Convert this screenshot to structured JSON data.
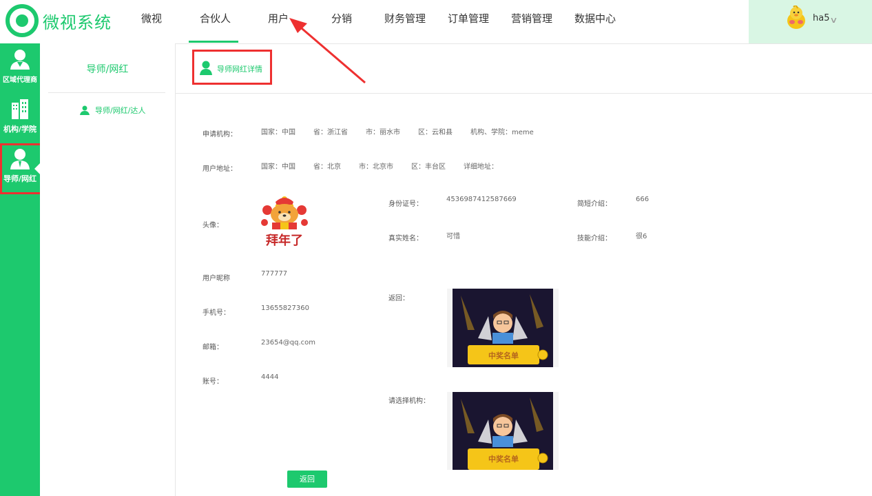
{
  "app": {
    "name": "微视系统"
  },
  "nav": {
    "items": [
      "微视",
      "合伙人",
      "用户",
      "分销",
      "财务管理",
      "订单管理",
      "营销管理",
      "数据中心"
    ],
    "active": "合伙人"
  },
  "user": {
    "name": "ha5"
  },
  "rail": {
    "items": [
      "区域代理商",
      "机构/学院",
      "导师/网红"
    ],
    "active": "导师/网红"
  },
  "sidebar": {
    "title": "导师/网红",
    "items": [
      "导师/网红/达人"
    ]
  },
  "tab": {
    "label": "导师网红详情"
  },
  "form": {
    "apply_org": {
      "label": "申请机构：",
      "country": "国家：中国",
      "province": "省：浙江省",
      "city": "市：丽水市",
      "district": "区：云和县",
      "school": "机构、学院：meme"
    },
    "address": {
      "label": "用户地址：",
      "country": "国家：中国",
      "province": "省：北京",
      "city": "市：北京市",
      "district": "区：丰台区",
      "detail": "详细地址："
    },
    "avatar_label": "头像：",
    "avatar_caption": "拜年了",
    "id_card": {
      "label": "身份证号：",
      "value": "4536987412587669"
    },
    "real_name": {
      "label": "真实姓名：",
      "value": "可惜"
    },
    "brief": {
      "label": "简短介绍：",
      "value": "666"
    },
    "skill": {
      "label": "技能介绍：",
      "value": "很6"
    },
    "nickname": {
      "label": "用户昵称",
      "value": "777777"
    },
    "phone": {
      "label": "手机号：",
      "value": "13655827360"
    },
    "email": {
      "label": "邮箱：",
      "value": "23654@qq.com"
    },
    "account": {
      "label": "账号：",
      "value": "4444"
    },
    "back_image": {
      "label": "返回：",
      "caption": "中奖名单"
    },
    "org_image": {
      "label": "请选择机构：",
      "caption": "中奖名单"
    },
    "back_button": "返回"
  },
  "colors": {
    "accent": "#1dc96e",
    "annotation": "#ee3030",
    "user_bg": "#d9f6e4"
  }
}
